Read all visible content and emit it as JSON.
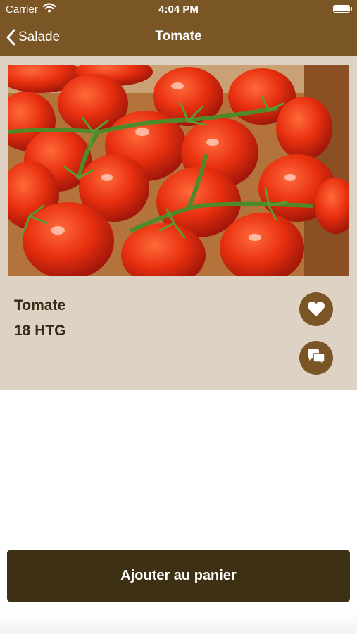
{
  "status_bar": {
    "carrier": "Carrier",
    "time": "4:04 PM",
    "icons": [
      "wifi-icon",
      "battery-icon"
    ]
  },
  "nav": {
    "back_label": "Salade",
    "title": "Tomate",
    "back_icon": "chevron-left-icon"
  },
  "product": {
    "name": "Tomate",
    "price": "18 HTG",
    "image_subject": "tomatoes-on-the-vine",
    "favorite_icon": "heart-icon",
    "chat_icon": "chat-bubbles-icon"
  },
  "cart": {
    "add_label": "Ajouter au panier"
  },
  "colors": {
    "header": "#7a5526",
    "card_background": "#ddd2c4",
    "cart_button": "#3d3014",
    "text_dark": "#3a2a15"
  }
}
